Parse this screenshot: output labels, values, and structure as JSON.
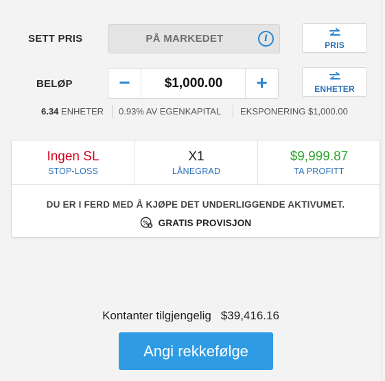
{
  "set_price": {
    "label": "SETT PRIS",
    "value": "PÅ MARKEDET",
    "info_icon": "info-icon",
    "toggle_label": "PRIS",
    "toggle_icon": "swap-arrows-icon"
  },
  "amount": {
    "label": "BELØP",
    "minus": "−",
    "value": "$1,000.00",
    "plus": "+",
    "toggle_label": "ENHETER",
    "toggle_icon": "swap-arrows-icon"
  },
  "info_line": {
    "units_number": "6.34",
    "units_label": " ENHETER",
    "equity": "0.93% AV EGENKAPITAL",
    "exposure": "EKSPONERING $1,000.00"
  },
  "trade_card": {
    "stop_loss_value": "Ingen SL",
    "stop_loss_label": "STOP-LOSS",
    "leverage_value": "X1",
    "leverage_label": "LÅNEGRAD",
    "take_profit_value": "$9,999.87",
    "take_profit_label": "TA PROFITT",
    "notice": "DU ER I FERD MED Å KJØPE DET UNDERLIGGENDE AKTIVUMET.",
    "commission": "GRATIS PROVISJON",
    "commission_icon": "commission-free-icon"
  },
  "footer": {
    "cash_label": "Kontanter tilgjengelig",
    "cash_value": "$39,416.16",
    "submit_label": "Angi rekkefølge"
  },
  "colors": {
    "accent_blue": "#2a86d1",
    "label_blue": "#2a6fb8",
    "stop_loss_red": "#d0021b",
    "take_profit_green": "#2ea62e",
    "submit_button": "#2e9be4"
  }
}
